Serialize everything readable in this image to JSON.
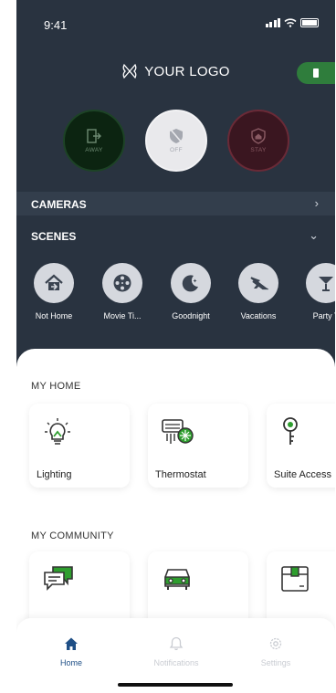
{
  "status": {
    "time": "9:41"
  },
  "header": {
    "logo_text": "YOUR LOGO"
  },
  "modes": [
    {
      "label": "AWAY"
    },
    {
      "label": "OFF"
    },
    {
      "label": "STAY"
    }
  ],
  "cameras": {
    "label": "CAMERAS"
  },
  "scenes": {
    "label": "SCENES",
    "items": [
      {
        "name": "Not Home",
        "icon": "house-arrow-icon"
      },
      {
        "name": "Movie Ti...",
        "icon": "film-reel-icon"
      },
      {
        "name": "Goodnight",
        "icon": "moon-icon"
      },
      {
        "name": "Vacations",
        "icon": "airplane-icon"
      },
      {
        "name": "Party T",
        "icon": "cocktail-icon"
      }
    ]
  },
  "my_home": {
    "label": "MY HOME",
    "cards": [
      {
        "label": "Lighting",
        "icon": "lightbulb-icon"
      },
      {
        "label": "Thermostat",
        "icon": "thermostat-icon"
      },
      {
        "label": "Suite Access",
        "icon": "key-icon"
      }
    ]
  },
  "my_community": {
    "label": "MY COMMUNITY",
    "cards": [
      {
        "label": "",
        "icon": "chat-icon"
      },
      {
        "label": "",
        "icon": "car-icon"
      },
      {
        "label": "",
        "icon": "package-icon"
      }
    ]
  },
  "tabs": [
    {
      "label": "Home",
      "icon": "home-icon",
      "active": true
    },
    {
      "label": "Notifications",
      "icon": "bell-icon",
      "active": false
    },
    {
      "label": "Settings",
      "icon": "gear-icon",
      "active": false
    }
  ],
  "colors": {
    "background_dark": "#293340",
    "accent_blue": "#1f4f86",
    "away_green": "#0c2411",
    "stay_red": "#3a1620",
    "icon_green": "#2e9e2e"
  }
}
